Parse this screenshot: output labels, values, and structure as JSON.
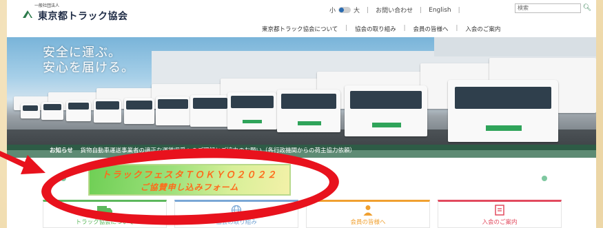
{
  "header": {
    "logo_small": "一般社団法人",
    "logo_text": "東京都トラック協会",
    "font_small": "小",
    "font_large": "大",
    "contact": "お問い合わせ",
    "english": "English",
    "search_placeholder": "検索"
  },
  "nav": {
    "items": [
      "東京都トラック協会について",
      "協会の取り組み",
      "会員の皆様へ",
      "入会のご案内"
    ]
  },
  "hero": {
    "line1": "安全に運ぶ。",
    "line2": "安心を届ける。"
  },
  "news": {
    "label": "お知らせ",
    "text": "貨物自動車運送事業者の適正な運賃収受へのご理解とご協力のお願い（各行政機関からの荷主協力依頼）"
  },
  "banner": {
    "line1": "トラックフェスタＴＯＫＹＯ２０２２",
    "line2": "ご協賛申し込みフォーム"
  },
  "cards": [
    {
      "label": "トラック協会について",
      "color": "#5cb85c",
      "icon": "truck-icon"
    },
    {
      "label": "協会の取り組み",
      "color": "#7aa7d6",
      "icon": "globe-icon"
    },
    {
      "label": "会員の皆様へ",
      "color": "#f0a030",
      "icon": "person-icon"
    },
    {
      "label": "入会のご案内",
      "color": "#e24a5e",
      "icon": "document-icon"
    }
  ],
  "colors": {
    "brand_green": "#2c7a4b",
    "annotation_red": "#e8121d",
    "banner_text": "#ff6a1a"
  }
}
